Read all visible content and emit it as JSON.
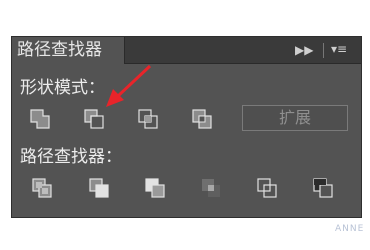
{
  "panel": {
    "tab_title": "路径查找器",
    "tab_controls": {
      "collapse_icon": "double-arrow-right-icon",
      "menu_icon": "panel-menu-icon"
    }
  },
  "shape_modes": {
    "label": "形状模式：",
    "buttons": [
      "unite-icon",
      "minus-front-icon",
      "intersect-icon",
      "exclude-icon"
    ],
    "expand_label": "扩展"
  },
  "pathfinders": {
    "label": "路径查找器：",
    "buttons": [
      "divide-icon",
      "trim-icon",
      "merge-icon",
      "crop-icon",
      "outline-icon",
      "minus-back-icon"
    ]
  },
  "annotation": {
    "arrow_color": "#e8242a"
  },
  "watermark": "ANNE"
}
